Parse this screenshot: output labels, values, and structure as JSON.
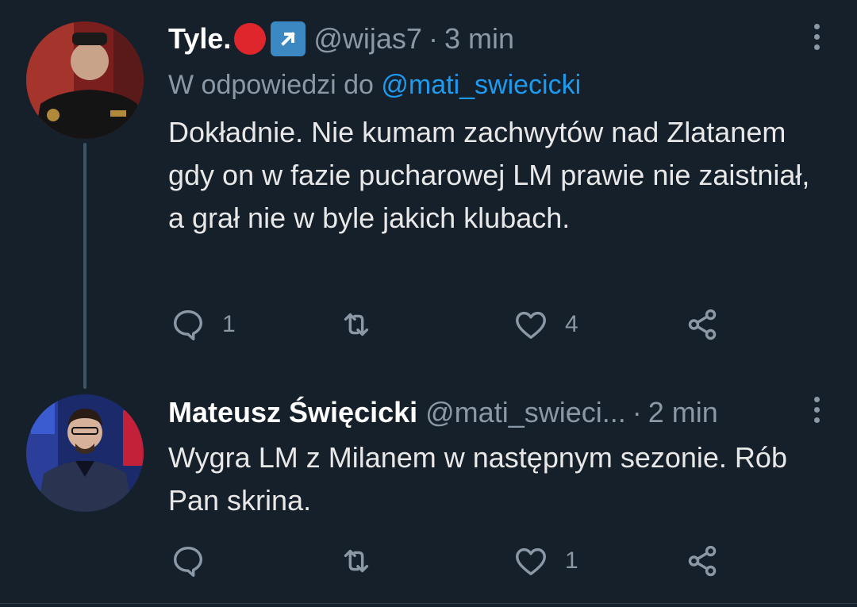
{
  "tweets": [
    {
      "author_name": "Tyle.",
      "handle": "@wijas7",
      "separator": "·",
      "time": "3 min",
      "reply_prefix": "W odpowiedzi do",
      "reply_mention": "@mati_swiecicki",
      "text": "Dokładnie. Nie kumam zachwytów nad Zlatanem gdy on w fazie pucharowej LM prawie nie zaistniał, a grał nie w byle jakich klubach.",
      "replies": "1",
      "retweets": "",
      "likes": "4"
    },
    {
      "author_name": "Mateusz Święcicki",
      "handle": "@mati_swieci...",
      "separator": "·",
      "time": "2 min",
      "text": "Wygra LM z Milanem w następnym sezonie. Rób Pan skrina.",
      "replies": "",
      "retweets": "",
      "likes": "1"
    }
  ],
  "icons": {
    "badge_1": "red-circle-icon",
    "badge_2": "arrow-up-right-icon",
    "more": "more-vertical-icon",
    "reply": "reply-icon",
    "retweet": "retweet-icon",
    "like": "heart-icon",
    "share": "share-icon"
  },
  "colors": {
    "background": "#15202b",
    "link": "#1d9bf0",
    "muted": "#8b98a5",
    "badge_red": "#e0262d",
    "badge_blue": "#3b88c3"
  }
}
